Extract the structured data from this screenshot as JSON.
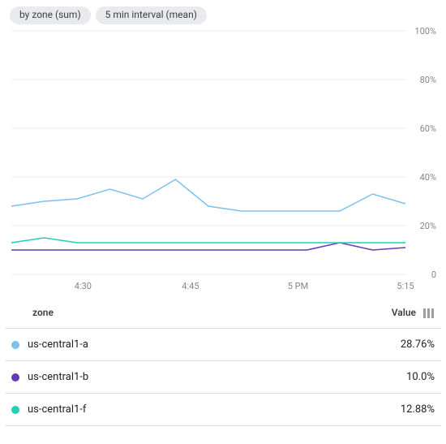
{
  "chips": [
    "by zone (sum)",
    "5 min interval (mean)"
  ],
  "table": {
    "headers": {
      "zone": "zone",
      "value": "Value"
    },
    "rows": [
      {
        "zone": "us-central1-a",
        "value": "28.76%",
        "color": "#7cc0ee"
      },
      {
        "zone": "us-central1-b",
        "value": "10.0%",
        "color": "#673ab7"
      },
      {
        "zone": "us-central1-f",
        "value": "12.88%",
        "color": "#1dd1b5"
      }
    ]
  },
  "chart_data": {
    "type": "line",
    "ylabel": "",
    "xlabel": "",
    "ylim": [
      0,
      100
    ],
    "x": [
      "4:20",
      "4:25",
      "4:30",
      "4:35",
      "4:40",
      "4:45",
      "4:50",
      "4:55",
      "5:00",
      "5:05",
      "5:10",
      "5:15"
    ],
    "x_ticks": [
      "4:30",
      "4:45",
      "5 PM",
      "5:15"
    ],
    "x_tick_idx": [
      2,
      5,
      8,
      11
    ],
    "y_ticks": [
      "100%",
      "80%",
      "60%",
      "40%",
      "20%",
      "0"
    ],
    "series": [
      {
        "name": "us-central1-a",
        "color": "#7cc0ee",
        "values": [
          28,
          30,
          31,
          35,
          31,
          39,
          28,
          26,
          26,
          26,
          26,
          33,
          29
        ]
      },
      {
        "name": "us-central1-b",
        "color": "#673ab7",
        "values": [
          10,
          10,
          10,
          10,
          10,
          10,
          10,
          10,
          10,
          10,
          13,
          10,
          11
        ]
      },
      {
        "name": "us-central1-f",
        "color": "#1dd1b5",
        "values": [
          13,
          15,
          13,
          13,
          13,
          13,
          13,
          13,
          13,
          13,
          13,
          13,
          13
        ]
      }
    ]
  }
}
